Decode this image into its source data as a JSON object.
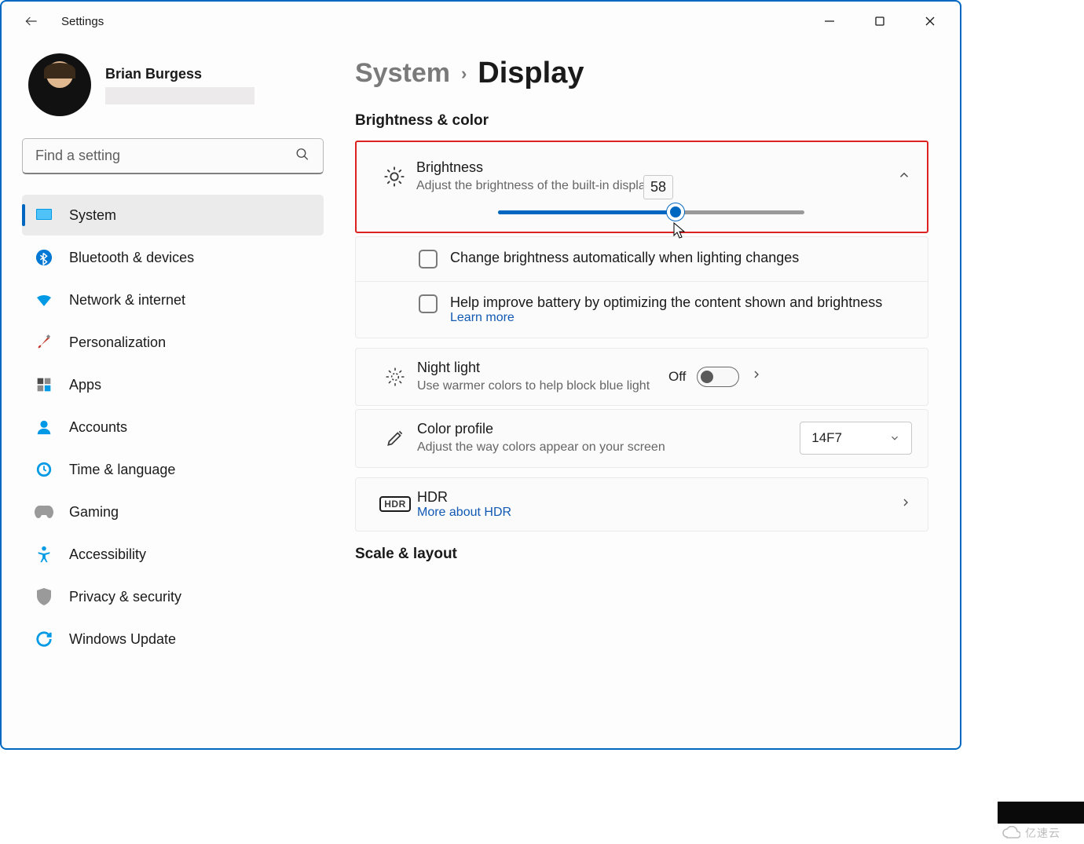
{
  "app": {
    "title": "Settings"
  },
  "user": {
    "name": "Brian Burgess"
  },
  "search": {
    "placeholder": "Find a setting"
  },
  "sidebar": {
    "items": [
      {
        "label": "System"
      },
      {
        "label": "Bluetooth & devices"
      },
      {
        "label": "Network & internet"
      },
      {
        "label": "Personalization"
      },
      {
        "label": "Apps"
      },
      {
        "label": "Accounts"
      },
      {
        "label": "Time & language"
      },
      {
        "label": "Gaming"
      },
      {
        "label": "Accessibility"
      },
      {
        "label": "Privacy & security"
      },
      {
        "label": "Windows Update"
      }
    ]
  },
  "breadcrumb": {
    "parent": "System",
    "current": "Display"
  },
  "sections": {
    "brightness": {
      "heading": "Brightness & color",
      "card_title": "Brightness",
      "card_desc": "Adjust the brightness of the built-in display",
      "value": "58",
      "auto_label": "Change brightness automatically when lighting changes",
      "battery_label": "Help improve battery by optimizing the content shown and brightness",
      "learn_more": "Learn more"
    },
    "night_light": {
      "title": "Night light",
      "desc": "Use warmer colors to help block blue light",
      "state": "Off"
    },
    "color_profile": {
      "title": "Color profile",
      "desc": "Adjust the way colors appear on your screen",
      "selected": "14F7"
    },
    "hdr": {
      "title": "HDR",
      "link": "More about HDR"
    },
    "scale": {
      "heading": "Scale & layout"
    }
  },
  "watermark": "亿速云"
}
